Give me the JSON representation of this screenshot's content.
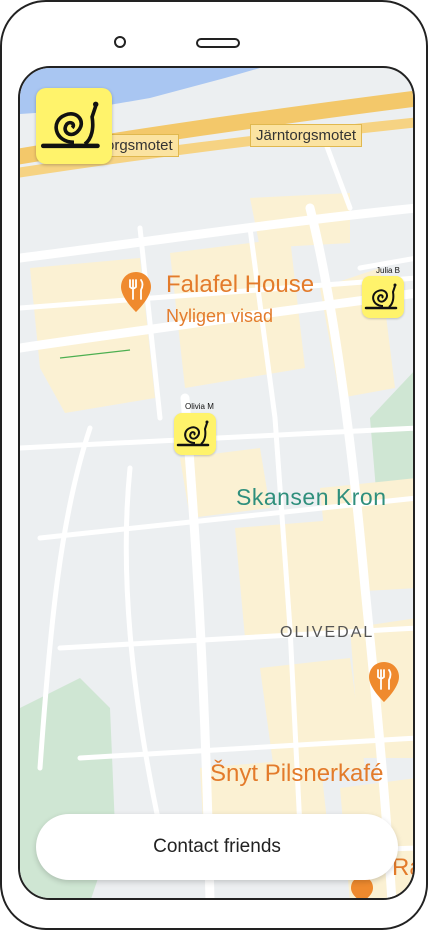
{
  "map": {
    "road_labels": [
      "orgsmotet",
      "Järntorgsmotet"
    ],
    "poi": {
      "name": "Falafel House",
      "subtitle": "Nyligen visad"
    },
    "park_label": "Skansen Kron",
    "district_label": "OLIVEDAL",
    "poi2": {
      "name": "Šnyt Pilsnerkafé"
    },
    "partial_label": "Ra"
  },
  "friends": [
    {
      "name": "Julia B"
    },
    {
      "name": "Olivia M"
    }
  ],
  "cta": {
    "label": "Contact friends"
  },
  "colors": {
    "accent_yellow": "#fff36b",
    "poi_orange": "#e37b2b",
    "park_teal": "#2f8f7c"
  }
}
